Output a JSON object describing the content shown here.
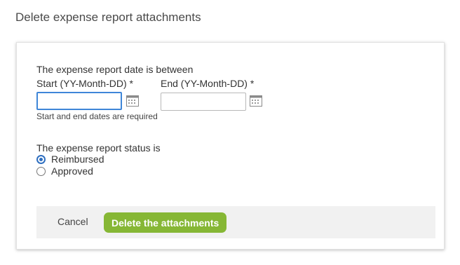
{
  "page": {
    "title": "Delete expense report attachments"
  },
  "date_section": {
    "heading": "The expense report date is between",
    "start_label": "Start (YY-Month-DD)  *",
    "end_label": "End (YY-Month-DD)  *",
    "start_value": "",
    "end_value": "",
    "hint": "Start and end dates are required",
    "calendar_icon": "calendar-icon"
  },
  "status_section": {
    "heading": "The expense report status is",
    "options": [
      {
        "label": "Reimbursed",
        "selected": true
      },
      {
        "label": "Approved",
        "selected": false
      }
    ]
  },
  "footer": {
    "cancel_label": "Cancel",
    "delete_label": "Delete the attachments"
  },
  "colors": {
    "accent_button": "#86b735",
    "focus_border": "#3f86d8",
    "radio_selected": "#2f6fc0"
  }
}
